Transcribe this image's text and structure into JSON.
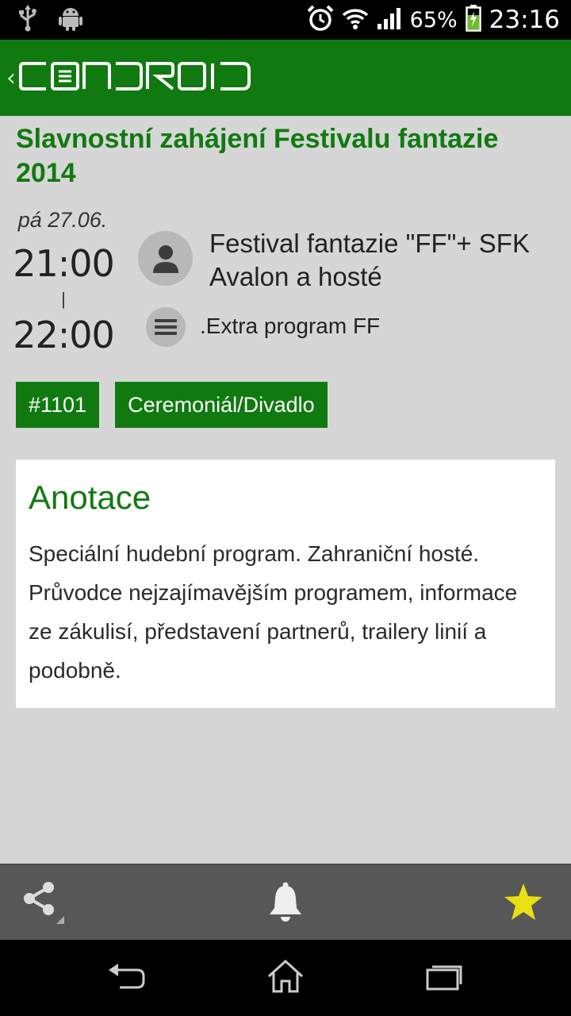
{
  "status_bar": {
    "battery_percent": "65%",
    "clock": "23:16",
    "icons": [
      "usb-icon",
      "android-icon",
      "alarm-icon",
      "wifi-icon",
      "signal-icon",
      "battery-charging-icon"
    ]
  },
  "action_bar": {
    "logo_text": "CONDROID",
    "up_icon": "up-caret-icon",
    "brand_color": "#107a10"
  },
  "event": {
    "title": "Slavnostní zahájení Festivalu fantazie 2014",
    "day": "pá 27.06.",
    "time_start": "21:00",
    "time_separator": "|",
    "time_end": "22:00",
    "author": "Festival fantazie \"FF\"+ SFK Avalon a hosté",
    "program": ".Extra program FF",
    "tags": [
      "#1101",
      "Ceremoniál/Divadlo"
    ]
  },
  "annotation": {
    "title": "Anotace",
    "text": "Speciální hudební program. Zahraniční hosté. Průvodce nejzajímavějším programem, informace ze zákulisí, představení partnerů, trailery linií a podobně."
  },
  "bottom_actions": {
    "share_icon": "share-icon",
    "reminder_icon": "bell-icon",
    "favorite_icon": "star-icon",
    "favorite_color": "#e8e010"
  },
  "system_nav": {
    "icons": [
      "back-icon",
      "home-icon",
      "recents-icon"
    ]
  }
}
